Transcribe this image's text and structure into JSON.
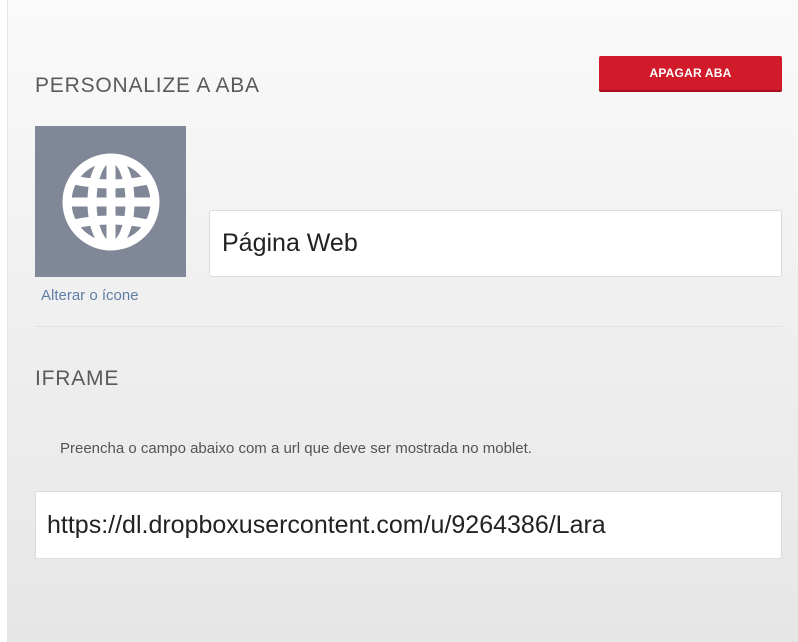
{
  "customize_section": {
    "title": "PERSONALIZE A ABA",
    "delete_button_label": "APAGAR ABA",
    "icon": "globe-icon",
    "change_icon_link": "Alterar o ícone",
    "tab_name_value": "Página Web"
  },
  "iframe_section": {
    "title": "IFRAME",
    "instructions": "Preencha o campo abaixo com a url que deve ser mostrada no moblet.",
    "url_value": "https://dl.dropboxusercontent.com/u/9264386/Lara"
  },
  "colors": {
    "delete_button": "#d11a2a",
    "icon_background": "#808797",
    "link": "#5f7ea6"
  }
}
